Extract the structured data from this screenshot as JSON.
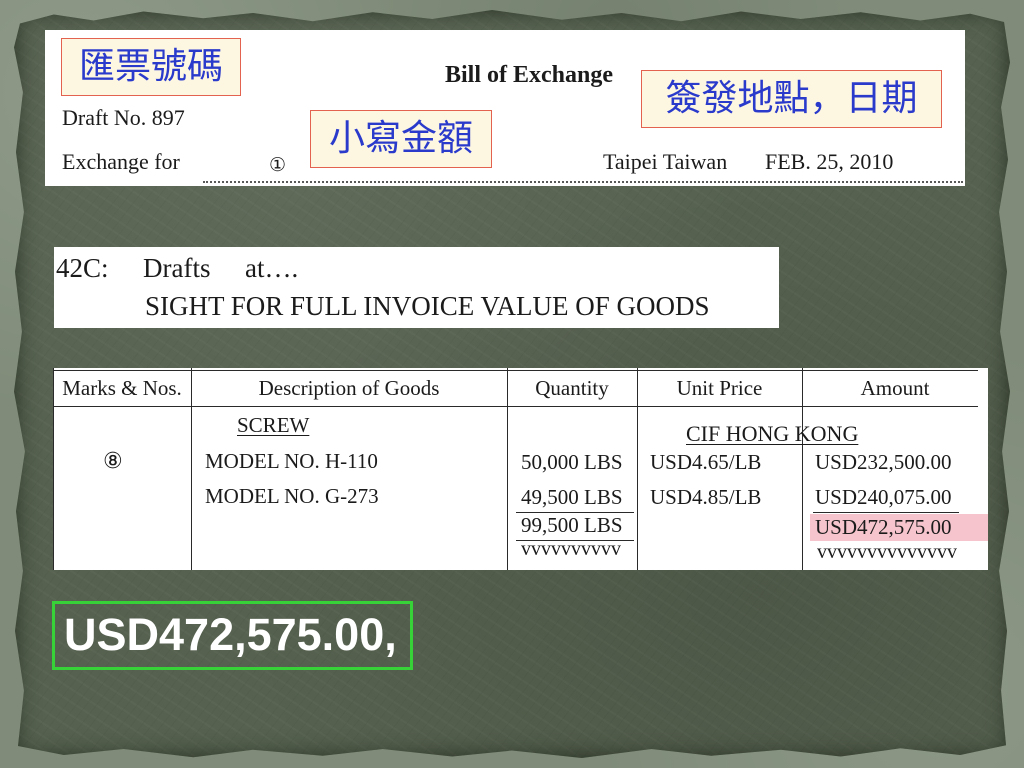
{
  "bill_of_exchange": {
    "title": "Bill of Exchange",
    "draft_no": "Draft No. 897",
    "exchange_for": "Exchange for",
    "amount_marker": "①",
    "place": "Taipei Taiwan",
    "date": "FEB. 25, 2010"
  },
  "callouts": {
    "draft_number": "匯票號碼",
    "amount_in_figures": "小寫金額",
    "place_and_date": "簽發地點，日期"
  },
  "lc_clause": {
    "tag": "42C:",
    "field_name": "Drafts",
    "field_suffix": "at….",
    "value": "SIGHT FOR FULL INVOICE VALUE OF GOODS"
  },
  "invoice_table": {
    "columns": [
      "Marks & Nos.",
      "Description of Goods",
      "Quantity",
      "Unit Price",
      "Amount"
    ],
    "shipping_mark": "⑧",
    "commodity": "SCREW",
    "price_term": "CIF HONG KONG",
    "rows": [
      {
        "description": "MODEL NO. H-110",
        "quantity": "50,000 LBS",
        "unit_price": "USD4.65/LB",
        "amount": "USD232,500.00"
      },
      {
        "description": "MODEL NO. G-273",
        "quantity": "49,500 LBS",
        "unit_price": "USD4.85/LB",
        "amount": "USD240,075.00"
      }
    ],
    "total_quantity": "99,500 LBS",
    "total_amount": "USD472,575.00",
    "quantity_close_marks": "vvvvvvvvvv",
    "amount_close_marks": "vvvvvvvvvvvvvv"
  },
  "answer": {
    "amount": "USD472,575.00,"
  },
  "colors": {
    "frame": "#808c79",
    "slide_background": "#56614f",
    "callout_text": "#2a3bcc",
    "callout_border": "#e2614f",
    "callout_fill": "#fdf6e1",
    "total_highlight": "#f5c4cc",
    "answer_border": "#37d237",
    "answer_text": "#ffffff"
  }
}
